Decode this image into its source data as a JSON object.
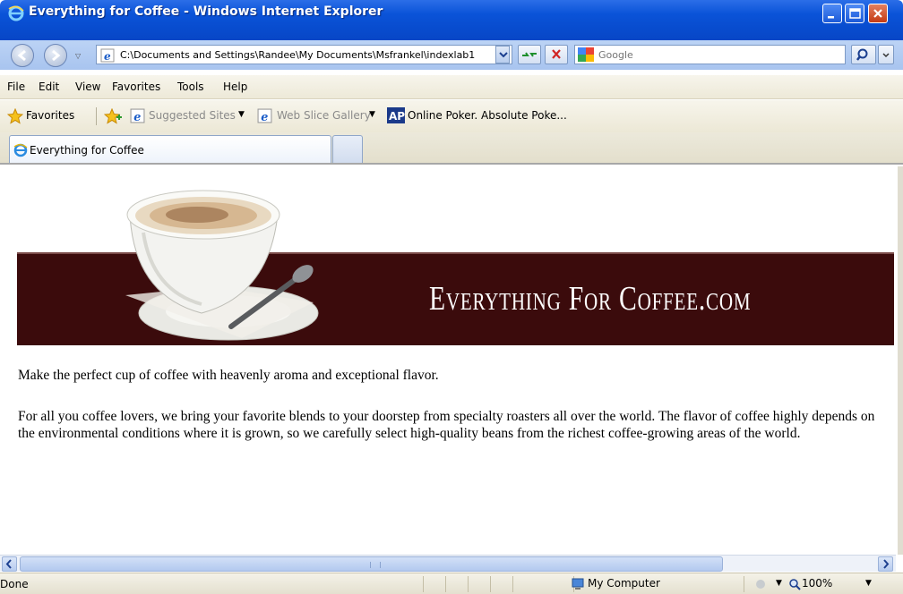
{
  "window": {
    "title": "Everything for Coffee - Windows Internet Explorer"
  },
  "address_bar": {
    "url": "C:\\Documents and Settings\\Randee\\My Documents\\Msfrankel\\indexlab1"
  },
  "search": {
    "placeholder": "Google"
  },
  "menu": {
    "items": [
      "File",
      "Edit",
      "View",
      "Favorites",
      "Tools",
      "Help"
    ]
  },
  "favorites_bar": {
    "favorites_label": "Favorites",
    "suggested_sites": "Suggested Sites",
    "web_slice_gallery": "Web Slice Gallery",
    "online_poker": "Online Poker. Absolute Poke..."
  },
  "tabs": [
    {
      "label": "Everything for Coffee"
    }
  ],
  "page": {
    "banner_text": "Everything For Coffee.com",
    "paragraph1": "Make the perfect cup of coffee with heavenly aroma and exceptional flavor.",
    "paragraph2": "For all you coffee lovers, we bring your favorite blends to your doorstep from specialty roasters all over the world. The flavor of coffee highly depends on the environmental conditions where it is grown, so we carefully select high-quality beans from the richest coffee-growing areas of the world."
  },
  "status_bar": {
    "status": "Done",
    "zone": "My Computer",
    "zoom": "100%"
  },
  "colors": {
    "banner_bg": "#3b0b0c",
    "titlebar": "#0a53d8"
  }
}
